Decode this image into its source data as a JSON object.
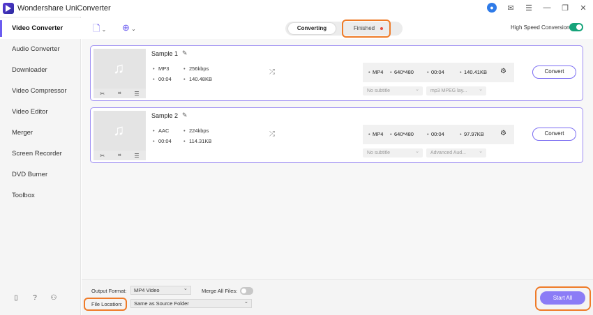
{
  "app": {
    "title": "Wondershare UniConverter"
  },
  "titlebar_icons": [
    "user-icon",
    "mail-icon",
    "menu-icon",
    "minimize-icon",
    "restore-icon",
    "close-icon"
  ],
  "sidebar": {
    "items": [
      {
        "label": "Video Converter",
        "active": true
      },
      {
        "label": "Audio Converter"
      },
      {
        "label": "Downloader"
      },
      {
        "label": "Video Compressor"
      },
      {
        "label": "Video Editor"
      },
      {
        "label": "Merger"
      },
      {
        "label": "Screen Recorder"
      },
      {
        "label": "DVD Burner"
      },
      {
        "label": "Toolbox"
      }
    ]
  },
  "tabs": {
    "converting": "Converting",
    "finished": "Finished"
  },
  "high_speed": {
    "label": "High Speed Conversion",
    "enabled": true
  },
  "files": [
    {
      "name": "Sample 1",
      "format": "MP3",
      "bitrate": "256kbps",
      "duration": "00:04",
      "size": "140.48KB",
      "out_format": "MP4",
      "out_resolution": "640*480",
      "out_duration": "00:04",
      "out_size": "140.41KB",
      "subtitle": "No subtitle",
      "audio_track": "mp3 MPEG lay...",
      "convert_label": "Convert"
    },
    {
      "name": "Sample 2",
      "format": "AAC",
      "bitrate": "224kbps",
      "duration": "00:04",
      "size": "114.31KB",
      "out_format": "MP4",
      "out_resolution": "640*480",
      "out_duration": "00:04",
      "out_size": "97.97KB",
      "subtitle": "No subtitle",
      "audio_track": "Advanced Aud...",
      "convert_label": "Convert"
    }
  ],
  "bottom": {
    "output_format_label": "Output Format:",
    "output_format_value": "MP4 Video",
    "merge_label": "Merge All Files:",
    "file_location_label": "File Location:",
    "file_location_value": "Same as Source Folder",
    "start_all": "Start All"
  },
  "colors": {
    "accent": "#6b5cf0",
    "highlight": "#ef7b28",
    "toggle_on": "#16a37a"
  }
}
